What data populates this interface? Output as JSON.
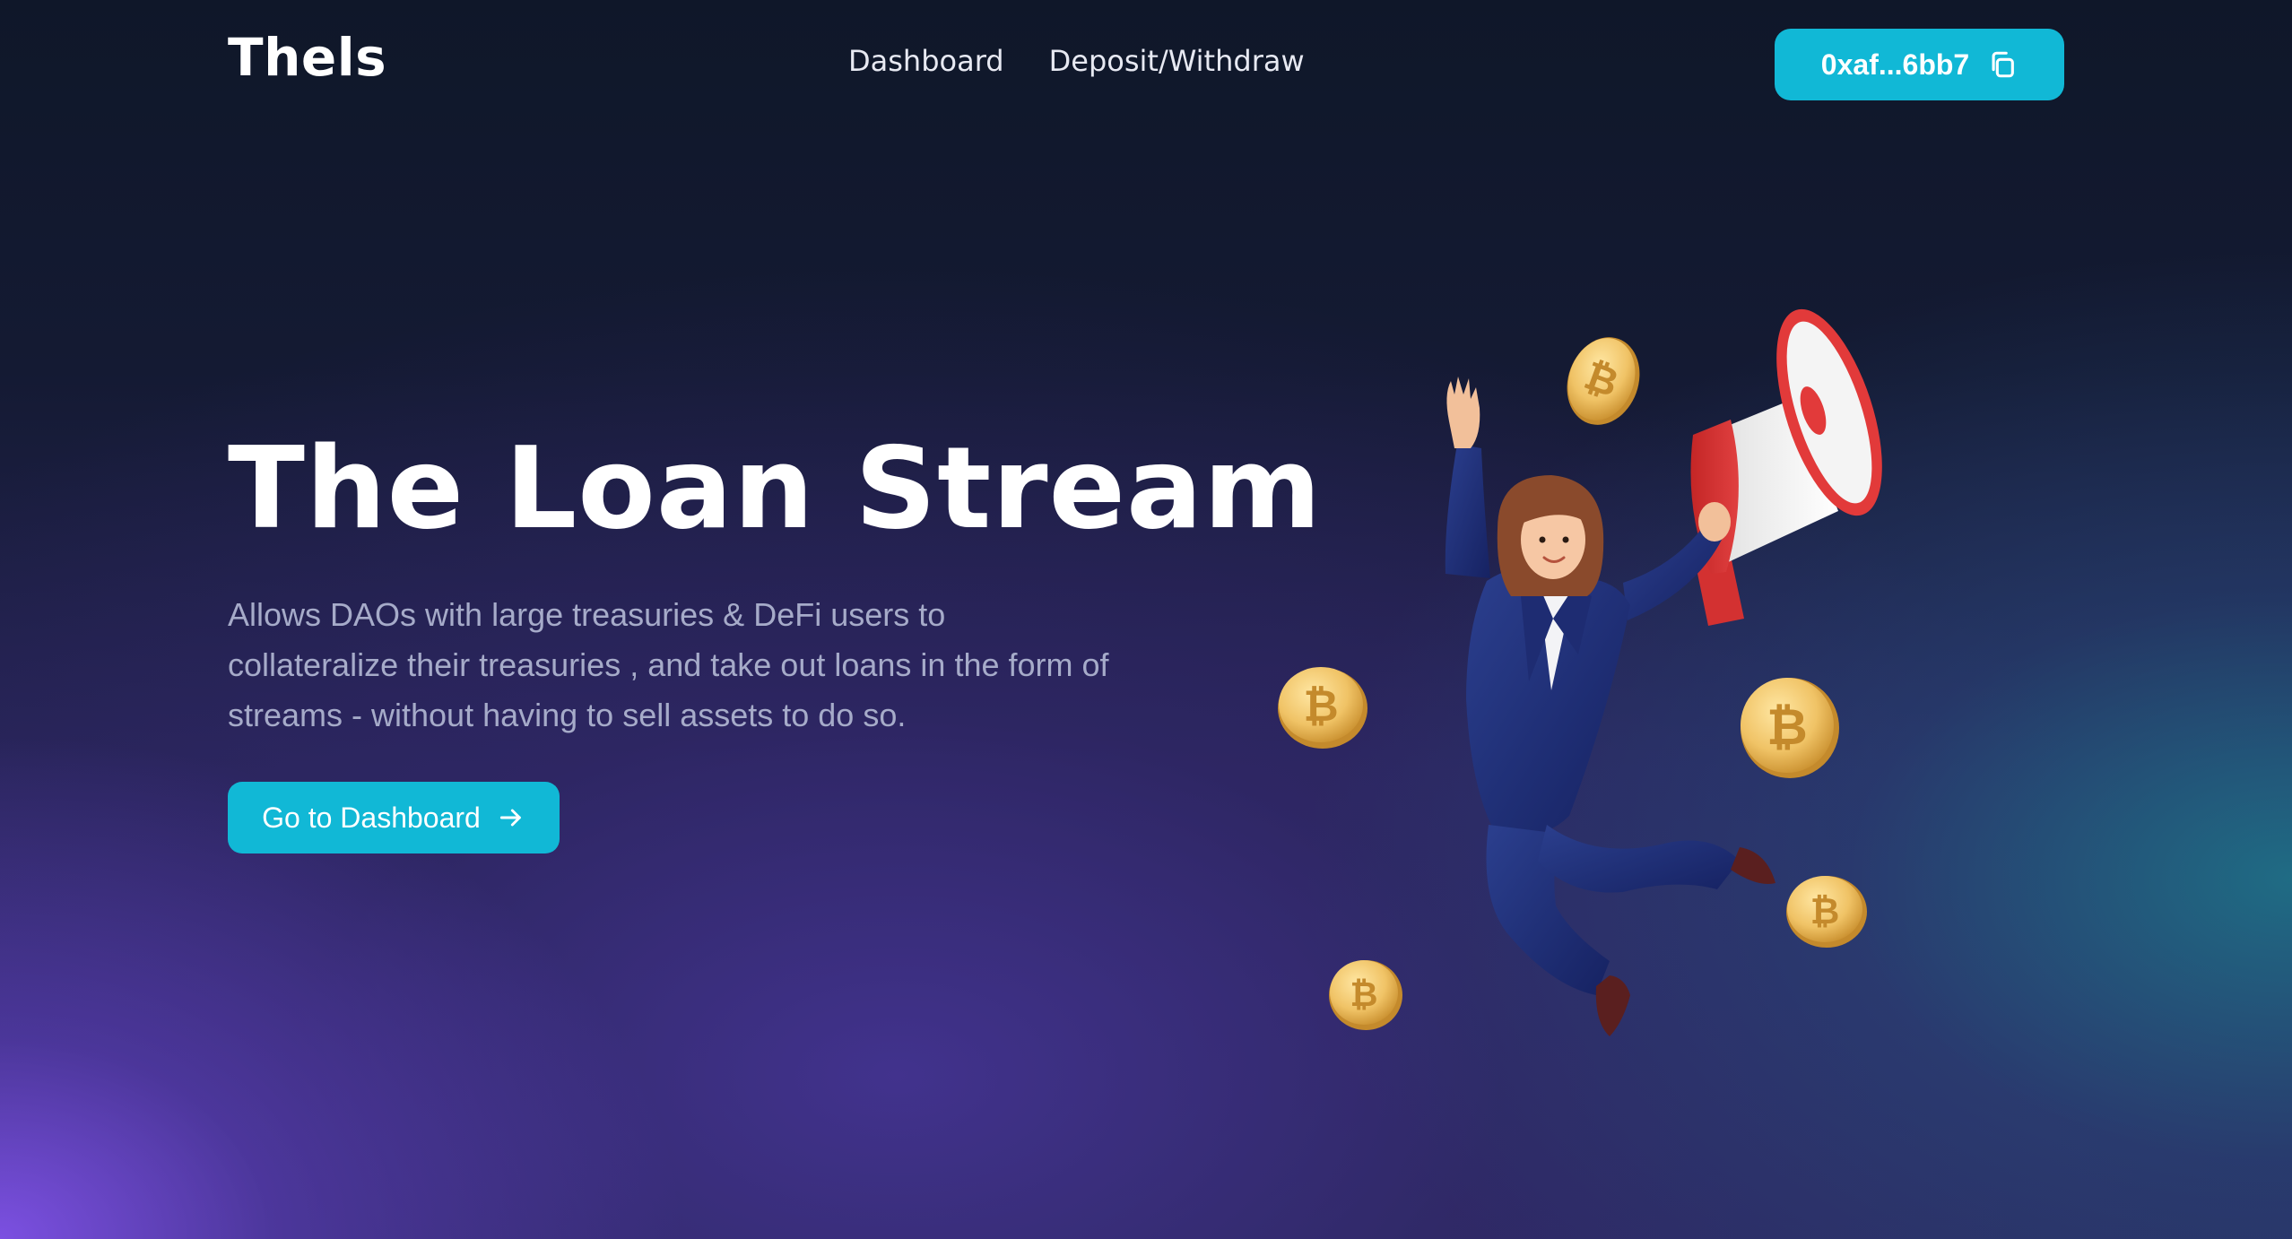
{
  "header": {
    "logo": "Thels",
    "nav": [
      {
        "label": "Dashboard"
      },
      {
        "label": "Deposit/Withdraw"
      }
    ],
    "wallet": {
      "address": "0xaf...6bb7",
      "icon": "copy-icon"
    }
  },
  "hero": {
    "title": "The Loan Stream",
    "description": "Allows DAOs with large treasuries & DeFi users to collateralize their treasuries , and take out loans in the form of streams - without having to sell assets to do so.",
    "cta_label": "Go to Dashboard",
    "cta_icon": "arrow-right-icon"
  },
  "colors": {
    "accent": "#11b8d6",
    "background_top": "#0f1729",
    "glow_purple": "#8052e8",
    "glow_teal": "#1e788c"
  }
}
